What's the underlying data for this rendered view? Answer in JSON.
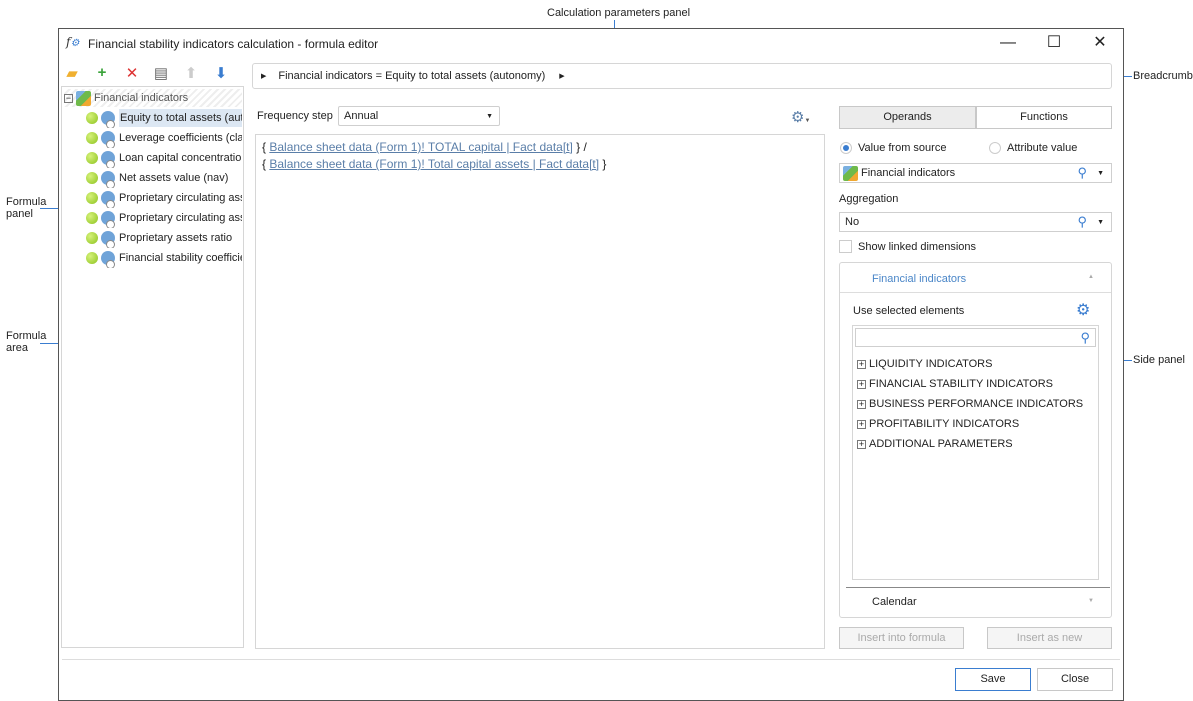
{
  "window": {
    "title": "Financial stability indicators calculation - formula editor",
    "minimize": "—",
    "maximize": "☐",
    "close": "✕"
  },
  "tree": {
    "root": "Financial indicators",
    "items": [
      "Equity to total assets (autonomy)",
      "Leverage coefficients (cla",
      "Loan capital concentration",
      "Net assets value (nav)",
      "Proprietary circulating ass",
      "Proprietary circulating ass",
      "Proprietary assets ratio",
      "Financial stability coefficie"
    ]
  },
  "breadcrumb": {
    "text": "Financial indicators = Equity to total assets (autonomy)"
  },
  "params": {
    "frequency_label": "Frequency step",
    "frequency_value": "Annual"
  },
  "formula": {
    "line1_open": "{ ",
    "line1_link": "Balance sheet data (Form 1)! TOTAL capital | Fact data[t]",
    "line1_close": " } /",
    "line2_open": "{ ",
    "line2_link": "Balance sheet data (Form 1)! Total capital assets | Fact data[t]",
    "line2_close": " }"
  },
  "side": {
    "tab_operands": "Operands",
    "tab_functions": "Functions",
    "radio_source": "Value from source",
    "radio_attribute": "Attribute value",
    "source_value": "Financial indicators",
    "aggregation_label": "Aggregation",
    "aggregation_value": "No",
    "show_linked": "Show linked dimensions",
    "group_title": "Financial indicators",
    "use_selected": "Use selected elements",
    "elements": [
      "LIQUIDITY INDICATORS",
      "FINANCIAL STABILITY INDICATORS",
      "BUSINESS PERFORMANCE INDICATORS",
      "PROFITABILITY INDICATORS",
      "ADDITIONAL PARAMETERS"
    ],
    "calendar": "Calendar",
    "insert_formula": "Insert into formula",
    "insert_new": "Insert as new"
  },
  "footer": {
    "save": "Save",
    "close": "Close"
  },
  "annotations": {
    "calc_params": "Calculation parameters panel",
    "breadcrumb": "Breadcrumb",
    "formula_panel": "Formula panel",
    "formula_area": "Formula area",
    "side_panel": "Side panel"
  }
}
